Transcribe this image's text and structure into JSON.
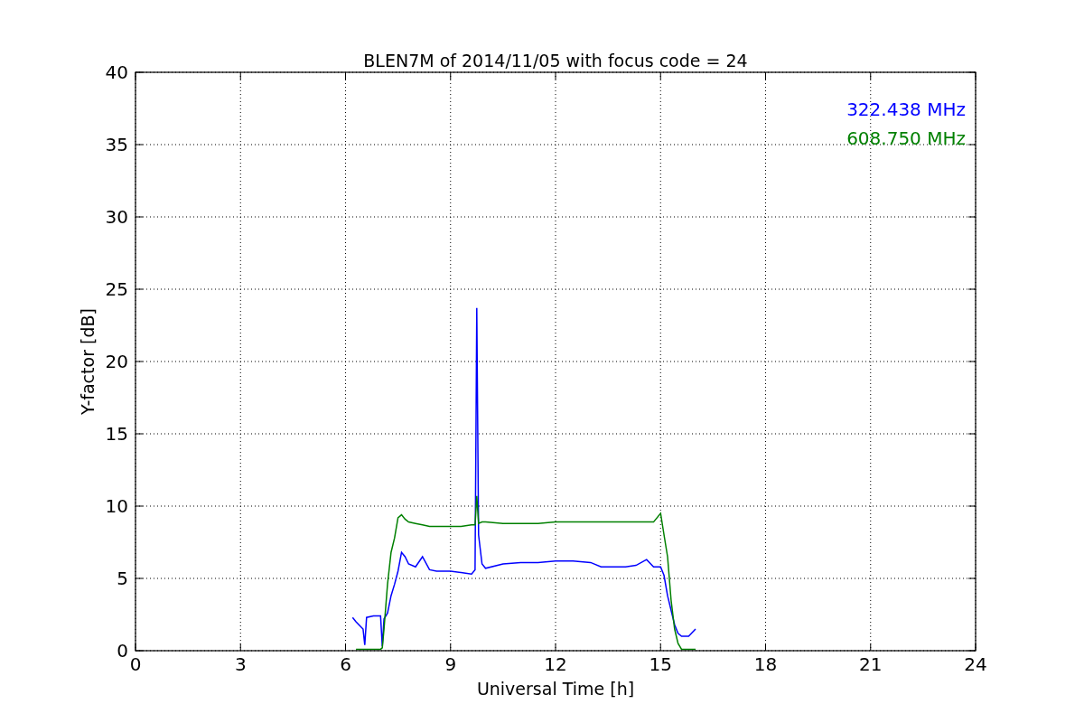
{
  "chart_data": {
    "type": "line",
    "title": "BLEN7M of 2014/11/05 with focus code = 24",
    "xlabel": "Universal Time [h]",
    "ylabel": "Y-factor [dB]",
    "x": [
      6.2,
      6.3,
      6.5,
      6.55,
      6.6,
      6.8,
      7.0,
      7.05,
      7.1,
      7.2,
      7.3,
      7.4,
      7.5,
      7.6,
      7.7,
      7.8,
      8.0,
      8.2,
      8.4,
      8.6,
      9.0,
      9.3,
      9.6,
      9.7,
      9.75,
      9.8,
      9.9,
      10.0,
      10.5,
      11.0,
      11.5,
      12.0,
      12.5,
      13.0,
      13.3,
      13.6,
      14.0,
      14.3,
      14.6,
      14.8,
      15.0,
      15.1,
      15.2,
      15.3,
      15.4,
      15.5,
      15.6,
      15.8,
      16.0
    ],
    "series": [
      {
        "name": "322.438 MHz",
        "color": "#0000ff",
        "values": [
          2.3,
          2.0,
          1.5,
          0.4,
          2.3,
          2.4,
          2.4,
          0.3,
          2.2,
          2.6,
          3.8,
          4.6,
          5.5,
          6.8,
          6.5,
          6.0,
          5.8,
          6.5,
          5.6,
          5.5,
          5.5,
          5.4,
          5.3,
          5.6,
          23.7,
          8.0,
          6.0,
          5.7,
          6.0,
          6.1,
          6.1,
          6.2,
          6.2,
          6.1,
          5.8,
          5.8,
          5.8,
          5.9,
          6.3,
          5.8,
          5.8,
          5.2,
          3.8,
          2.8,
          1.8,
          1.2,
          1.0,
          1.0,
          1.5
        ]
      },
      {
        "name": "608.750 MHz",
        "color": "#008000",
        "values": [
          null,
          0.1,
          0.1,
          0.1,
          0.1,
          0.1,
          0.1,
          0.2,
          1.5,
          4.6,
          6.8,
          7.8,
          9.2,
          9.4,
          9.1,
          8.9,
          8.8,
          8.7,
          8.6,
          8.6,
          8.6,
          8.6,
          8.7,
          8.7,
          10.7,
          8.8,
          8.9,
          8.9,
          8.8,
          8.8,
          8.8,
          8.9,
          8.9,
          8.9,
          8.9,
          8.9,
          8.9,
          8.9,
          8.9,
          8.9,
          9.5,
          8.0,
          6.5,
          3.5,
          1.5,
          0.5,
          0.1,
          0.1,
          0.1
        ]
      }
    ],
    "xlim": [
      0,
      24
    ],
    "ylim": [
      0,
      40
    ],
    "grid": true,
    "xticks": [
      0,
      3,
      6,
      9,
      12,
      15,
      18,
      21,
      24
    ],
    "yticks": [
      0,
      5,
      10,
      15,
      20,
      25,
      30,
      35,
      40
    ]
  }
}
